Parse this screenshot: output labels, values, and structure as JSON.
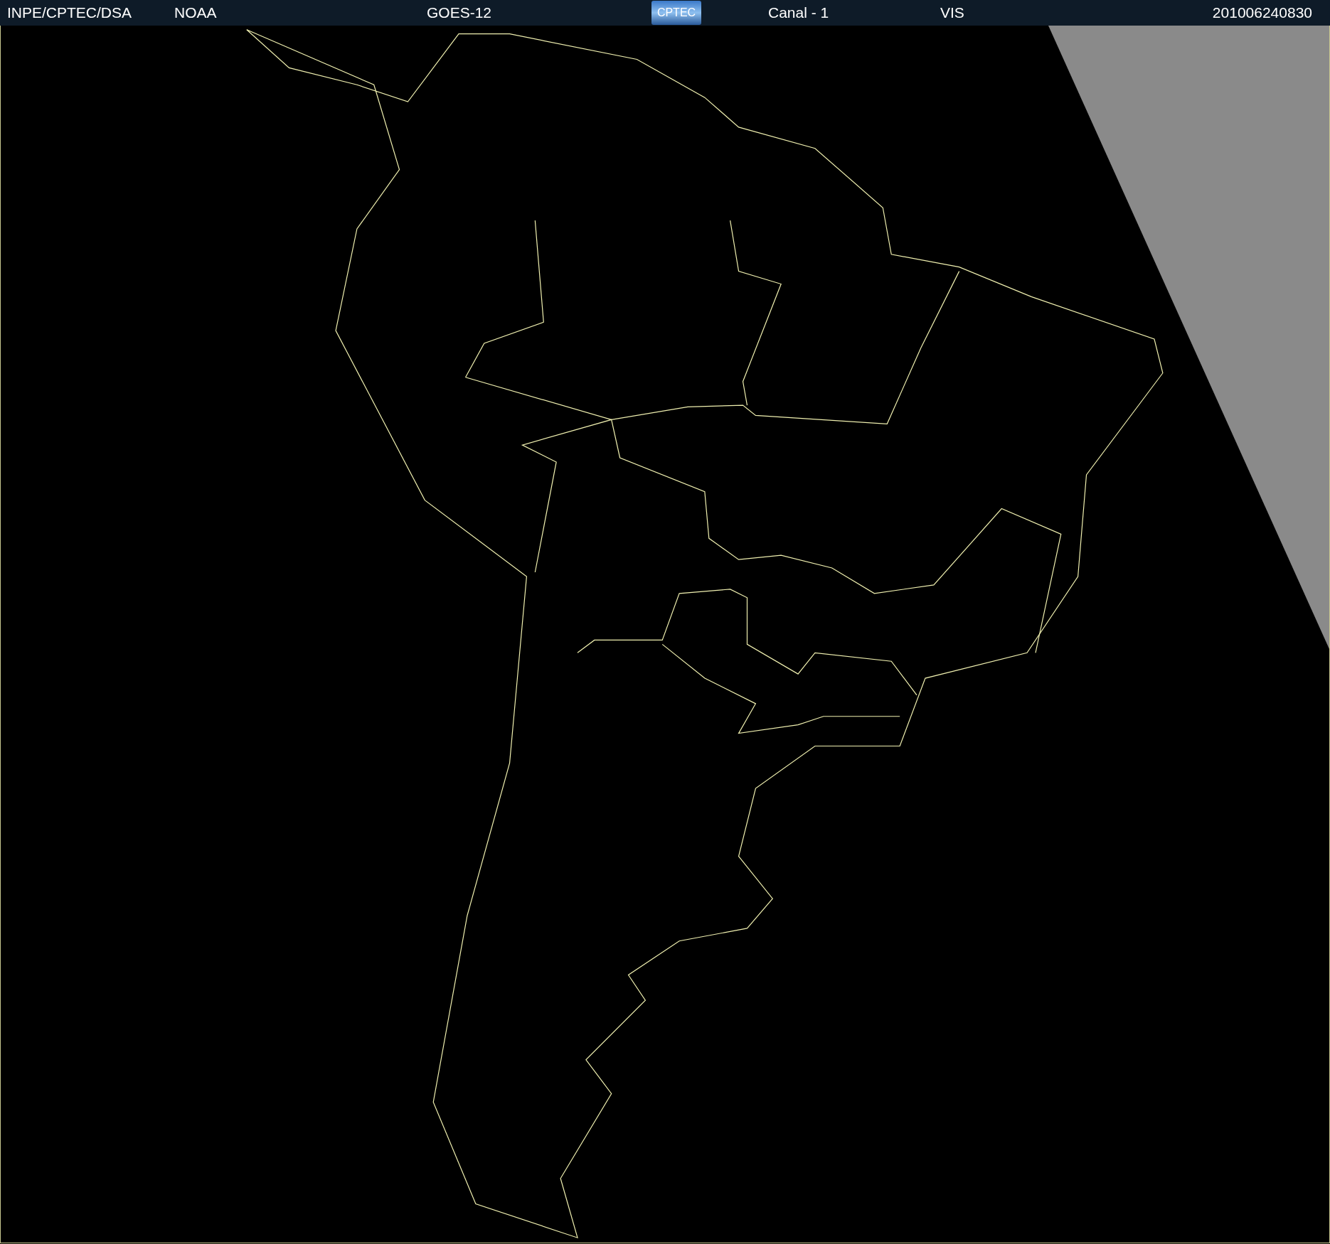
{
  "header": {
    "source": "INPE/CPTEC/DSA",
    "agency": "NOAA",
    "satellite": "GOES-12",
    "logo": "CPTEC",
    "channel": "Canal - 1",
    "band": "VIS",
    "timestamp": "201006240830"
  }
}
